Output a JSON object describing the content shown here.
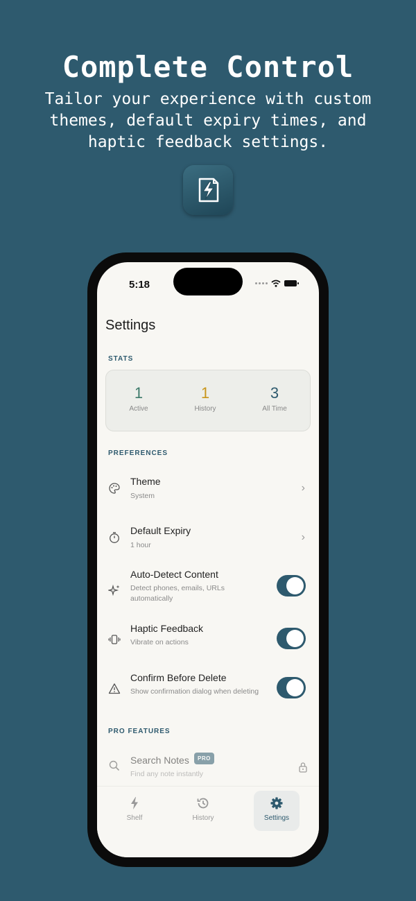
{
  "promo": {
    "headline": "Complete Control",
    "subhead": "Tailor your experience with custom themes, default expiry times, and haptic feedback settings."
  },
  "status_bar": {
    "time": "5:18"
  },
  "page_title": "Settings",
  "stats": {
    "section_label": "STATS",
    "items": [
      {
        "value": "1",
        "label": "Active",
        "color": "#3d7a6a"
      },
      {
        "value": "1",
        "label": "History",
        "color": "#c9961c"
      },
      {
        "value": "3",
        "label": "All Time",
        "color": "#2e5a6e"
      }
    ]
  },
  "preferences": {
    "section_label": "PREFERENCES",
    "items": [
      {
        "icon": "palette-icon",
        "title": "Theme",
        "subtitle": "System",
        "control": "chevron"
      },
      {
        "icon": "timer-icon",
        "title": "Default Expiry",
        "subtitle": "1 hour",
        "control": "chevron"
      },
      {
        "icon": "sparkles-icon",
        "title": "Auto-Detect Content",
        "subtitle": "Detect phones, emails, URLs automatically",
        "control": "toggle",
        "enabled": true
      },
      {
        "icon": "vibrate-icon",
        "title": "Haptic Feedback",
        "subtitle": "Vibrate on actions",
        "control": "toggle",
        "enabled": true
      },
      {
        "icon": "warning-icon",
        "title": "Confirm Before Delete",
        "subtitle": "Show confirmation dialog when deleting",
        "control": "toggle",
        "enabled": true
      }
    ]
  },
  "pro_features": {
    "section_label": "PRO FEATURES",
    "items": [
      {
        "icon": "search-icon",
        "title": "Search Notes",
        "badge": "PRO",
        "subtitle": "Find any note instantly",
        "locked": true
      }
    ]
  },
  "tabbar": {
    "tabs": [
      {
        "icon": "bolt-icon",
        "label": "Shelf",
        "active": false
      },
      {
        "icon": "history-icon",
        "label": "History",
        "active": false
      },
      {
        "icon": "gear-icon",
        "label": "Settings",
        "active": true
      }
    ]
  },
  "colors": {
    "background": "#2e5a6e",
    "accent": "#2e5a6e",
    "screen": "#f8f7f3"
  }
}
